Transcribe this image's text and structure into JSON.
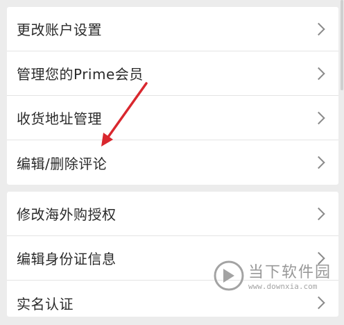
{
  "groups": [
    {
      "items": [
        {
          "label": "更改账户设置"
        },
        {
          "label": "管理您的Prime会员"
        },
        {
          "label": "收货地址管理"
        },
        {
          "label": "编辑/删除评论"
        }
      ]
    },
    {
      "items": [
        {
          "label": "修改海外购授权"
        },
        {
          "label": "编辑身份证信息"
        },
        {
          "label": "实名认证"
        }
      ]
    }
  ],
  "watermark": {
    "name": "当下软件园",
    "url": "www.downxia.com"
  },
  "colors": {
    "background": "#ececec",
    "card": "#ffffff",
    "annotation_arrow": "#d9272e",
    "chevron": "#8a8a8a"
  },
  "icons": {
    "row_chevron": "chevron-right-icon",
    "annotation": "red-arrow-icon",
    "watermark_logo": "downxia-logo-icon"
  }
}
